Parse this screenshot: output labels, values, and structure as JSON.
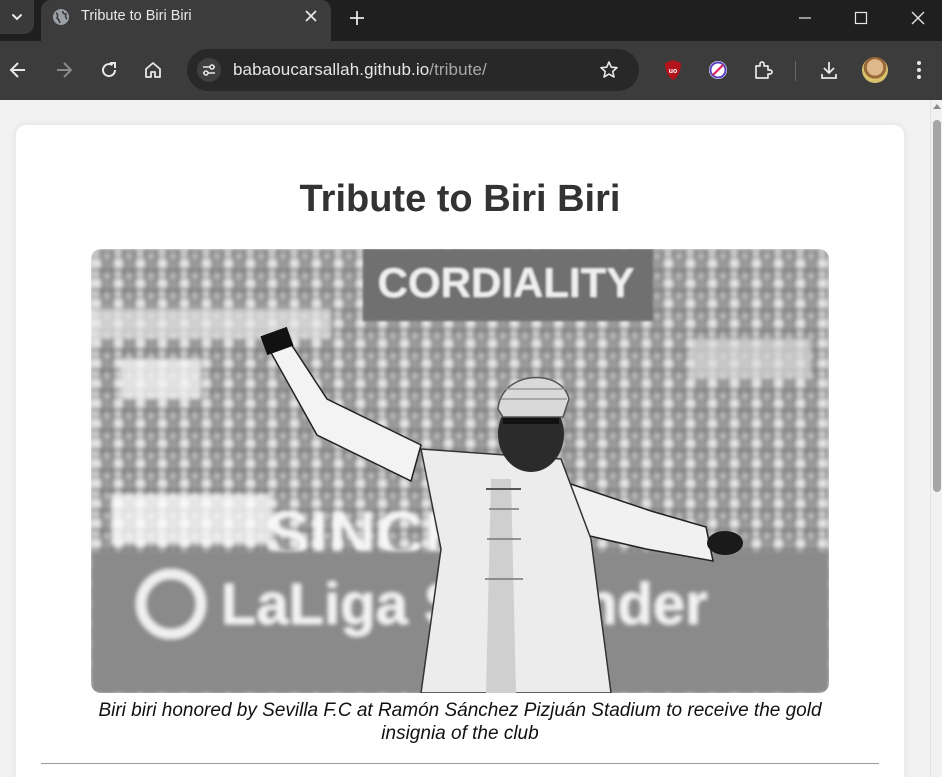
{
  "browser": {
    "tab": {
      "title": "Tribute to Biri Biri"
    },
    "url": {
      "host": "babaoucarsallah.github.io",
      "path": "/tribute/"
    },
    "icons": {
      "tab_search": "chevron-down-icon",
      "favicon": "globe-icon",
      "tab_close": "close-icon",
      "new_tab": "plus-icon",
      "minimize": "minimize-icon",
      "maximize": "maximize-icon",
      "window_close": "close-icon",
      "back": "arrow-left-icon",
      "forward": "arrow-right-icon",
      "reload": "reload-icon",
      "home": "home-icon",
      "site_info": "tune-icon",
      "bookmark": "star-icon",
      "ublock": "ublock-shield-icon",
      "blocker": "no-entry-icon",
      "extensions": "puzzle-icon",
      "downloads": "download-icon",
      "menu": "three-dots-icon"
    }
  },
  "page": {
    "title": "Tribute to Biri Biri",
    "photo": {
      "banner_text": "CORDIALITY",
      "ad_board_text": "LaLiga Santander",
      "stand_text": "SINCE",
      "style": "grayscale"
    },
    "caption": "Biri biri honored by Sevilla F.C at Ramón Sánchez Pizjuán Stadium to receive the gold insignia of the club"
  },
  "colors": {
    "tabstrip": "#1f1f1f",
    "toolbar": "#3c3c3c",
    "omnibox": "#282828",
    "page_bg": "#f2f2f2",
    "card_bg": "#ffffff",
    "title_text": "#333333",
    "ublock_red": "#b3131a",
    "blocker_purple": "#5a3fc0"
  }
}
